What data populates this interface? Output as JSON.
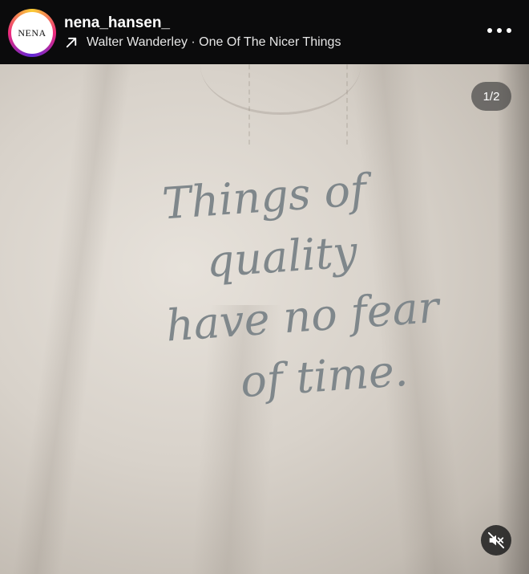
{
  "header": {
    "avatar_text": "NENA",
    "username": "nena_hansen_",
    "song": "Walter Wanderley · One Of The Nicer Things",
    "arrow_icon": "arrow-up-right-icon",
    "more_icon": "more-horizontal-icon"
  },
  "media": {
    "shirt_text": [
      "Things of",
      "quality",
      "have no fear",
      "of time."
    ],
    "counter": "1/2",
    "mute_icon": "speaker-muted-icon"
  },
  "colors": {
    "header_bg": "#0b0b0c",
    "shirt_text": "#7f878b",
    "shirt_fabric": "#d8d2ca"
  }
}
